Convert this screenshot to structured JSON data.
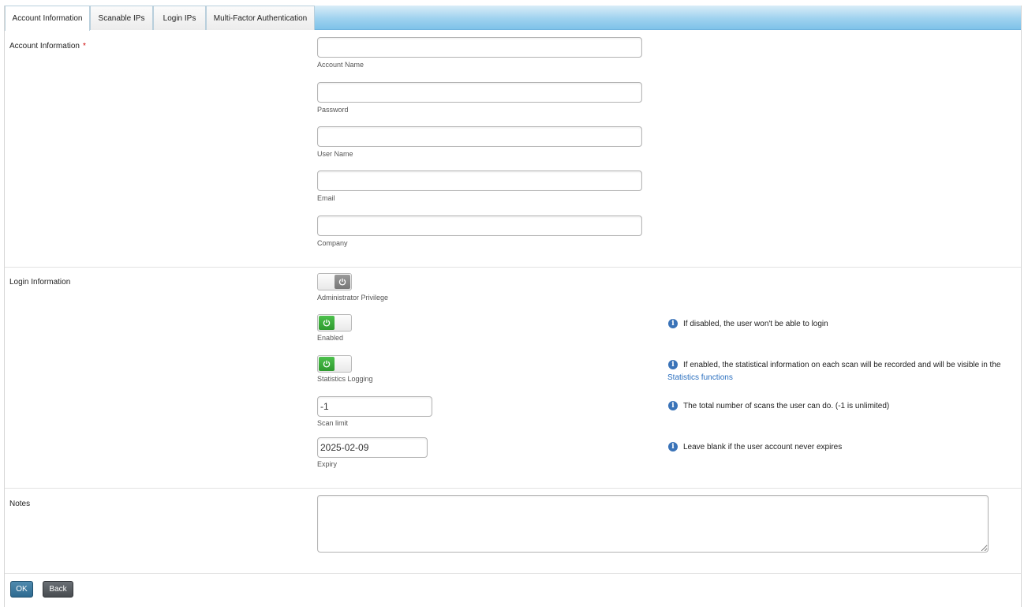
{
  "tabs": [
    {
      "label": "Account Information",
      "active": true
    },
    {
      "label": "Scanable IPs",
      "active": false
    },
    {
      "label": "Login IPs",
      "active": false
    },
    {
      "label": "Multi-Factor Authentication",
      "active": false
    }
  ],
  "account": {
    "section_label": "Account Information",
    "required_mark": "*",
    "fields": [
      {
        "caption": "Account Name",
        "value": ""
      },
      {
        "caption": "Password",
        "value": ""
      },
      {
        "caption": "User Name",
        "value": ""
      },
      {
        "caption": "Email",
        "value": ""
      },
      {
        "caption": "Company",
        "value": ""
      }
    ]
  },
  "login": {
    "section_label": "Login Information",
    "admin": {
      "caption": "Administrator Privilege",
      "state": "off"
    },
    "enabled": {
      "caption": "Enabled",
      "state": "on",
      "info": "If disabled, the user won't be able to login"
    },
    "stats": {
      "caption": "Statistics Logging",
      "state": "on",
      "info": "If enabled, the statistical information on each scan will be recorded and will be visible in the",
      "link": "Statistics functions"
    },
    "scan_limit": {
      "caption": "Scan limit",
      "value": "-1",
      "info": "The total number of scans the user can do. (-1 is unlimited)"
    },
    "expiry": {
      "caption": "Expiry",
      "value": "2025-02-09",
      "info": "Leave blank if the user account never expires"
    }
  },
  "notes": {
    "section_label": "Notes",
    "value": ""
  },
  "buttons": {
    "ok": "OK",
    "back": "Back"
  },
  "colors": {
    "tab_bar": "#9fd2ef",
    "toggle_on": "#3aa83a",
    "info_icon": "#3a73b8",
    "link": "#2a6fbf",
    "ok_button": "#3d7aa0",
    "back_button": "#55595e",
    "required": "#cc0000"
  }
}
